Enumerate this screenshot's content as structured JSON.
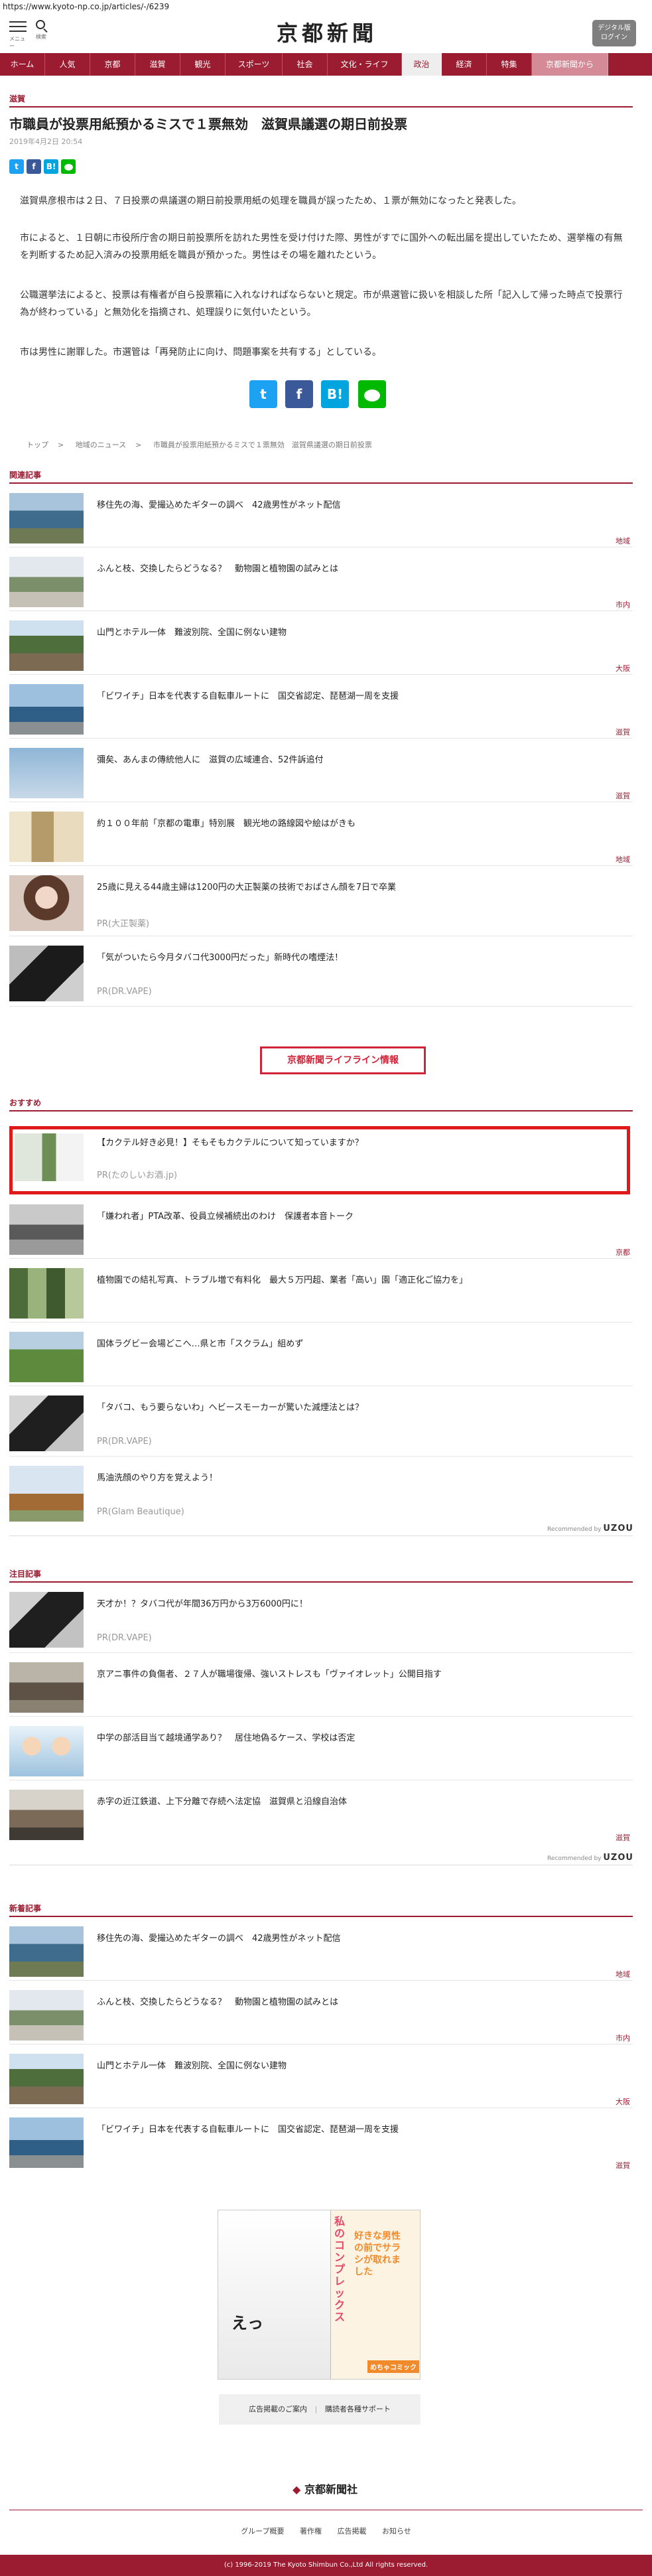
{
  "browser": {
    "url": "https://www.kyoto-np.co.jp/articles/-/6239"
  },
  "header": {
    "menu_label": "メニュー",
    "search_label": "検索",
    "logo_text": "京都新聞",
    "digital_button": "デジタル版\nログイン"
  },
  "nav": {
    "items": [
      "ホーム",
      "人気",
      "京都",
      "滋賀",
      "観光",
      "スポーツ",
      "社会",
      "文化・ライフ",
      "政治",
      "経済",
      "特集",
      "京都新聞から"
    ],
    "active_index": 8
  },
  "article": {
    "section": "滋賀",
    "title": "市職員が投票用紙預かるミスで１票無効　滋賀県議選の期日前投票",
    "date": "2019年4月2日 20:54",
    "paragraphs": [
      "滋賀県彦根市は２日、７日投票の県議選の期日前投票用紙の処理を職員が誤ったため、１票が無効になったと発表した。",
      "市によると、１日朝に市役所庁舎の期日前投票所を訪れた男性を受け付けた際、男性がすでに国外への転出届を提出していたため、選挙権の有無を判断するため記入済みの投票用紙を職員が預かった。男性はその場を離れたという。",
      "公職選挙法によると、投票は有権者が自ら投票箱に入れなければならないと規定。市が県選管に扱いを相談した所「記入して帰った時点で投票行為が終わっている」と無効化を指摘され、処理誤りに気付いたという。",
      "市は男性に謝罪した。市選管は「再発防止に向け、問題事案を共有する」としている。"
    ],
    "breadcrumb": [
      "トップ",
      "地域のニュース",
      "市職員が投票用紙預かるミスで１票無効　滋賀県議選の期日前投票"
    ]
  },
  "share": {
    "twitter": "t",
    "facebook": "f",
    "hatena": "B!",
    "line": "LINE"
  },
  "related": {
    "heading": "関連記事",
    "items": [
      {
        "title": "移住先の海、愛撮込めたギターの調べ　42歳男性がネット配信",
        "category": "地域"
      },
      {
        "title": "ふんと枝、交換したらどうなる？　動物園と植物園の試みとは",
        "category": "市内"
      },
      {
        "title": "山門とホテル一体　難波別院、全国に例ない建物",
        "category": "大阪"
      },
      {
        "title": "「ビワイチ」日本を代表する自転車ルートに　国交省認定、琵琶湖一周を支援",
        "category": "滋賀"
      },
      {
        "title": "彌矣、あんまの傳統他人に　滋賀の広域連合、52件訴追付",
        "category": "滋賀"
      },
      {
        "title": "約１００年前「京都の電車」特別展　観光地の路線図や絵はがきも",
        "category": "地域"
      },
      {
        "title": "25歳に見える44歳主婦は1200円の大正製薬の技術でおばさん顔を7日で卒業",
        "pr": "PR(大正製薬)"
      },
      {
        "title": "「気がついたら今月タバコ代3000円だった」新時代の嗜煙法！",
        "pr": "PR(DR.VAPE)"
      }
    ]
  },
  "lifeline_button": "京都新聞ライフライン情報",
  "recommended": {
    "heading": "おすすめ",
    "items": [
      {
        "title": "【カクテル好き必見！】そもそもカクテルについて知っていますか？",
        "pr": "PR(たのしいお酒.jp)"
      },
      {
        "title": "「嫌われ者」PTA改革、役員立候補続出のわけ　保護者本音トーク",
        "category": "京都"
      },
      {
        "title": "植物園での結礼写真、トラブル増で有料化　最大５万円超、業者「高い」園「適正化ご協力を」",
        "category": ""
      },
      {
        "title": "国体ラグビー会場どこへ…県と市「スクラム」組めず",
        "category": ""
      },
      {
        "title": "「タバコ、もう要らないわ」ヘビースモーカーが驚いた減煙法とは？",
        "pr": "PR(DR.VAPE)"
      },
      {
        "title": "馬油洗顔のやり方を覚えよう！",
        "pr": "PR(Glam Beautique)"
      }
    ],
    "recommended_by": "Recommended by",
    "provider": "UZOU"
  },
  "featured": {
    "heading": "注目記事",
    "items": [
      {
        "title": "天才か！？タバコ代が年間36万円から3万6000円に！",
        "pr": "PR(DR.VAPE)"
      },
      {
        "title": "京アニ事件の負傷者、２７人が職場復帰、強いストレスも「ヴァイオレット」公開目指す",
        "category": ""
      },
      {
        "title": "中学の部活目当て越境通学あり？　居住地偽るケース、学校は否定",
        "category": ""
      },
      {
        "title": "赤字の近江鉄道、上下分離で存続へ法定協　滋賀県と沿線自治体",
        "category": "滋賀"
      }
    ],
    "recommended_by": "Recommended by",
    "provider": "UZOU"
  },
  "latest": {
    "heading": "新着記事",
    "items": [
      {
        "title": "移住先の海、愛撮込めたギターの調べ　42歳男性がネット配信",
        "category": "地域"
      },
      {
        "title": "ふんと枝、交換したらどうなる？　動物園と植物園の試みとは",
        "category": "市内"
      },
      {
        "title": "山門とホテル一体　難波別院、全国に例ない建物",
        "category": "大阪"
      },
      {
        "title": "「ビワイチ」日本を代表する自転車ルートに　国交省認定、琵琶湖一周を支援",
        "category": "滋賀"
      }
    ]
  },
  "ad": {
    "text_top": "私のコンプレックス",
    "text_mid": "好きな男性の前でサラシが取れました",
    "badge": "めちゃコミック",
    "exclaim": "えっ"
  },
  "ad_links": [
    "広告掲載のご案内",
    "購読者各種サポート"
  ],
  "footer": {
    "company": "京都新聞社",
    "links": [
      "グループ概要",
      "著作権",
      "広告掲載",
      "お知らせ"
    ],
    "copyright": "(c) 1996-2019 The Kyoto Shimbun Co.,Ltd All rights reserved."
  }
}
